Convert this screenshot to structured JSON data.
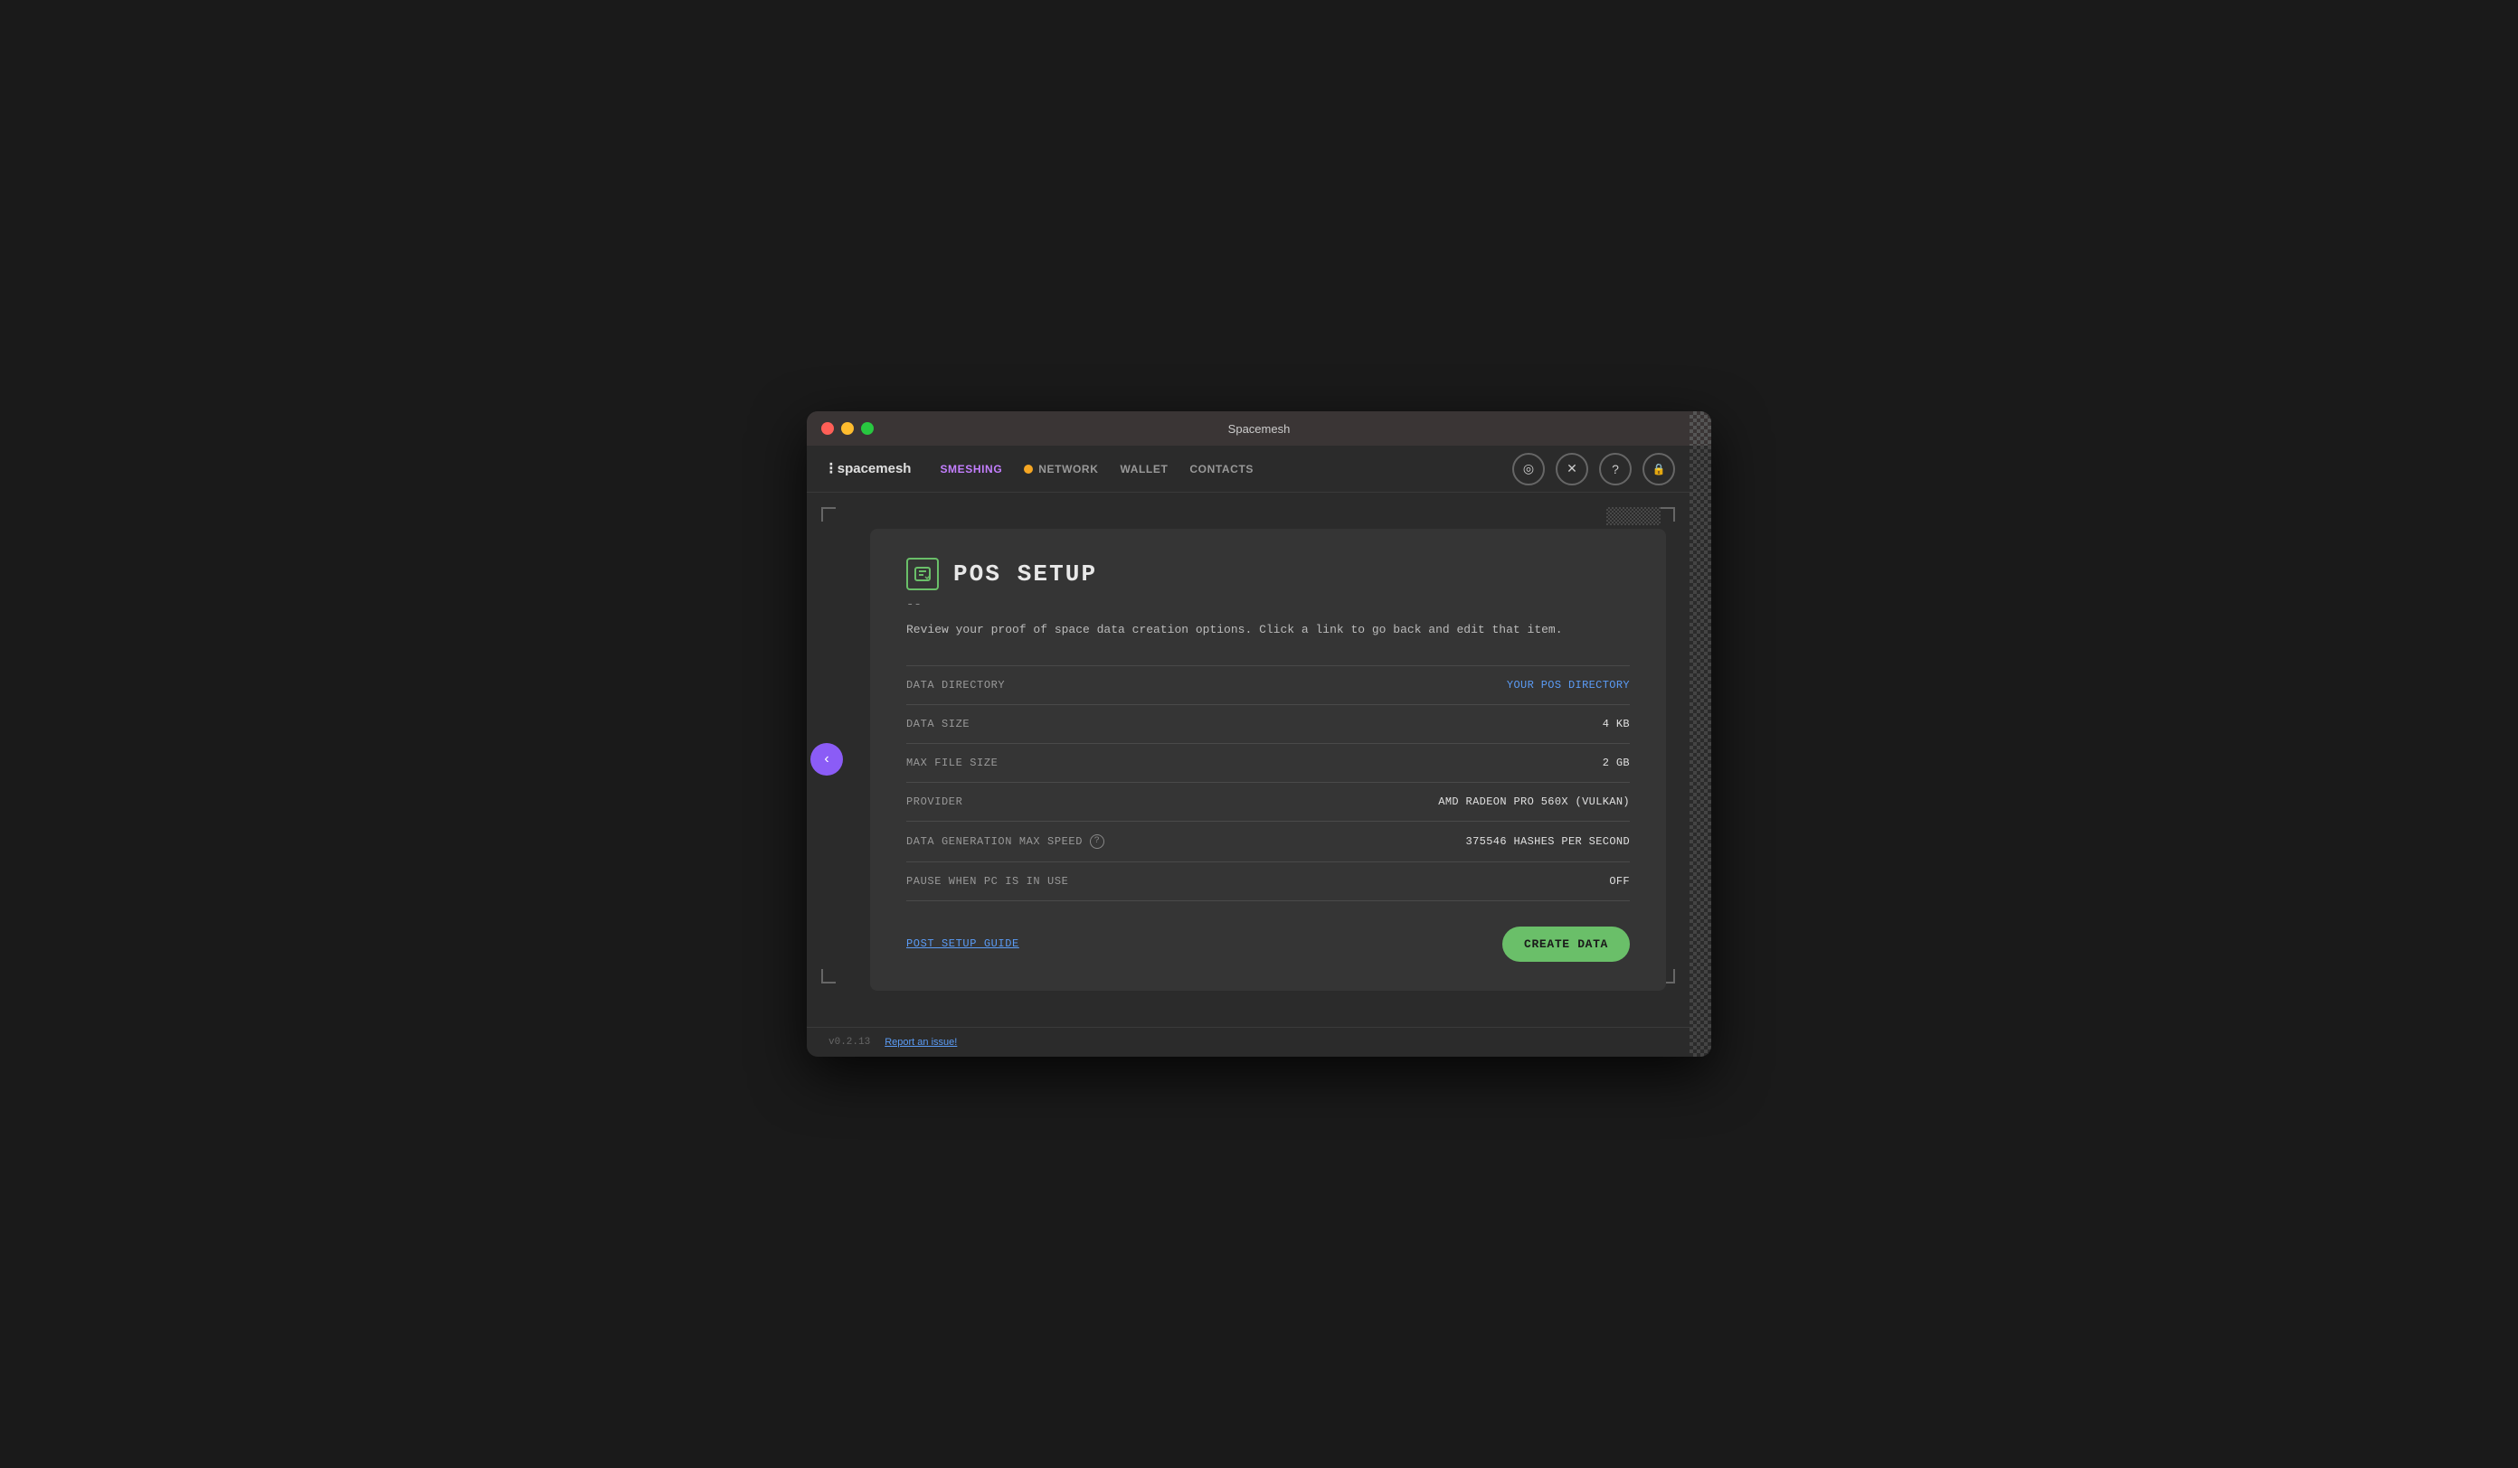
{
  "window": {
    "title": "Spacemesh"
  },
  "titlebar": {
    "title": "Spacemesh"
  },
  "navbar": {
    "logo_symbol": "⁝",
    "logo_text": "spacemesh",
    "items": [
      {
        "id": "smeshing",
        "label": "SMESHING",
        "active": true
      },
      {
        "id": "network",
        "label": "NETWORK",
        "has_dot": true
      },
      {
        "id": "wallet",
        "label": "WALLET",
        "active": false
      },
      {
        "id": "contacts",
        "label": "CONTACTS",
        "active": false
      }
    ],
    "right_icons": [
      {
        "id": "target-icon",
        "symbol": "◎"
      },
      {
        "id": "atom-icon",
        "symbol": "✕"
      },
      {
        "id": "help-icon",
        "symbol": "?"
      },
      {
        "id": "lock-icon",
        "symbol": "🔒"
      }
    ]
  },
  "pos_setup": {
    "title": "POS  SETUP",
    "separator": "--",
    "description": "Review your proof of space data creation options. Click a link to go back\nand edit that item.",
    "rows": [
      {
        "id": "data-directory",
        "label": "DATA DIRECTORY",
        "value": "YOUR POS DIRECTORY",
        "is_link": true
      },
      {
        "id": "data-size",
        "label": "DATA SIZE",
        "value": "4 KB",
        "is_link": false
      },
      {
        "id": "max-file-size",
        "label": "MAX FILE SIZE",
        "value": "2 GB",
        "is_link": false
      },
      {
        "id": "provider",
        "label": "PROVIDER",
        "value": "AMD RADEON PRO 560X (VULKAN)",
        "is_link": false
      },
      {
        "id": "data-generation-max-speed",
        "label": "DATA GENERATION MAX SPEED",
        "value": "375546 HASHES PER SECOND",
        "is_link": false,
        "has_help": true
      },
      {
        "id": "pause-when-pc-in-use",
        "label": "PAUSE WHEN PC IS IN USE",
        "value": "OFF",
        "is_link": false
      }
    ],
    "post_setup_guide_label": "POST SETUP GUIDE",
    "create_data_label": "CREATE DATA"
  },
  "footer": {
    "version": "v0.2.13",
    "report_link": "Report an issue!"
  }
}
